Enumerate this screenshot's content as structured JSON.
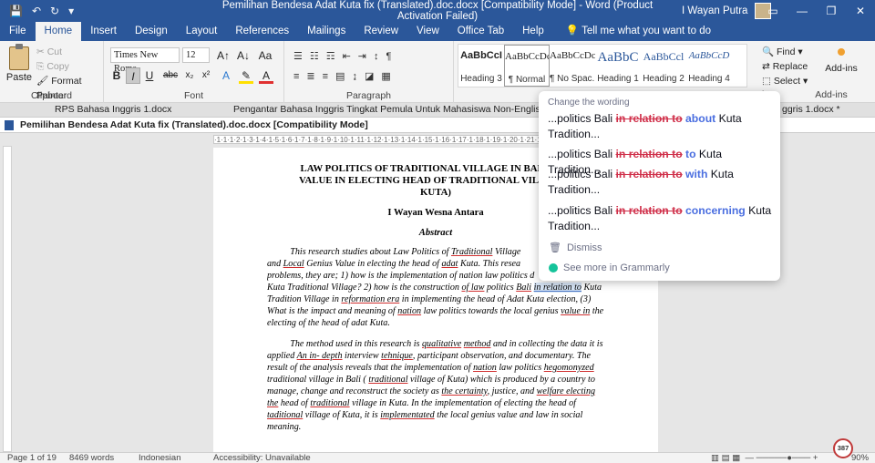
{
  "titlebar": {
    "title": "Pemilihan Bendesa Adat Kuta fix (Translated).doc.docx [Compatibility Mode] - Word (Product Activation Failed)",
    "user": "I Wayan Putra"
  },
  "tabs": [
    "File",
    "Home",
    "Insert",
    "Design",
    "Layout",
    "References",
    "Mailings",
    "Review",
    "View",
    "Office Tab",
    "Help"
  ],
  "tell_me": "Tell me what you want to do",
  "ribbon": {
    "clipboard": {
      "paste": "Paste",
      "cut": "Cut",
      "copy": "Copy",
      "format_painter": "Format Painter",
      "label": "Clipboard"
    },
    "font": {
      "name": "Times New Roma",
      "size": "12",
      "label": "Font"
    },
    "paragraph": {
      "label": "Paragraph"
    },
    "styles": [
      {
        "sample": "AaBbCcI",
        "name": "Heading 3"
      },
      {
        "sample": "AaBbCcDc",
        "name": "¶ Normal"
      },
      {
        "sample": "AaBbCcDc",
        "name": "¶ No Spac..."
      },
      {
        "sample": "AaBbC",
        "name": "Heading 1"
      },
      {
        "sample": "AaBbCcl",
        "name": "Heading 2"
      },
      {
        "sample": "AaBbCcD",
        "name": "Heading 4"
      }
    ],
    "editing": {
      "find": "Find",
      "replace": "Replace",
      "select": "Select"
    },
    "addins": {
      "label": "Add-ins",
      "group": "Add-ins"
    },
    "editing_group": "ing"
  },
  "doc_tabs": {
    "tab1": "RPS Bahasa Inggris 1.docx",
    "tab2": "Pengantar Bahasa Inggris Tingkat Pemula Untuk Mahasiswa Non-English Department.",
    "tab3": "ggris 1.docx *",
    "active": "Pemilihan Bendesa Adat Kuta fix (Translated).doc.docx [Compatibility Mode]"
  },
  "document": {
    "title_l1": "LAW  POLITICS OF TRADITIONAL VILLAGE  IN BALI AND",
    "title_l2": "VALUE  IN ELECTING HEAD OF TRADITIONAL VILLAGE  (",
    "title_l3": "KUTA)",
    "author": "I Wayan Wesna Antara",
    "abstract": "Abstract",
    "p1": {
      "l1": "This research studies about Law Politics of ",
      "l1_ul": "Traditional",
      "l1b": " Village",
      "l2a": "and ",
      "l2_ul1": "Local",
      "l2b": " Genius Value in electing the head of ",
      "l2_ul2": "adat",
      "l2c": " Kuta. This resea",
      "l3": "problems, they are; 1) how is the implementation of nation law politics d",
      "l4": "Kuta Traditional Village? 2) how is the construction ",
      "l4_ul1": "of  law",
      "l4b": " politics ",
      "l4_ul2": "Bali",
      "l4c": "  ",
      "l4_hl": "in relation to",
      "l4d": " Kuta",
      "l5a": "Tradition Village in ",
      "l5_ul": "reformation  era",
      "l5b": " in implementing the head of Adat Kuta election, (3)",
      "l6a": "What is the impact and meaning of ",
      "l6_ul1": "nation",
      "l6b": " law politics towards the local genius ",
      "l6_ul2": "value  in",
      "l6c": " the",
      "l7": "electing of the head of adat Kuta."
    },
    "p2": {
      "l1a": "The method used in this research is ",
      "l1_ul1": "qualitative",
      "l1b": " ",
      "l1_ul2": "method",
      "l1c": " and in collecting the data it is",
      "l2a": "applied ",
      "l2_ul1": "An  in-  depth",
      "l2b": " interview ",
      "l2_ul2": "tehnique",
      "l2c": ",  participant  observation,  and  documentary.  The",
      "l3a": "result  of  the  analysis  reveals  that  the  implementation  of  ",
      "l3_ul1": "nation",
      "l3b": "  law  politics  ",
      "l3_ul2": "hegomonyzed",
      "l4a": "traditional  village  in  Bali  ( ",
      "l4_ul": "traditional",
      "l4b": "  village of Kuta)  which  is produced  by  a  country  to",
      "l5a": "manage,   change and reconstruct the society as ",
      "l5_ul1": "the  certainty",
      "l5b": ",  justice,  and  ",
      "l5_ul2": "welfare electing",
      "l6_ul1": "the",
      "l6a": "  head  of  ",
      "l6_ul2": "traditional",
      "l6b": "  village  in  Kuta.  In  the  implementation  of  electing  the  head  of",
      "l7_ul1": "taditional",
      "l7a": " village of Kuta,  it  is  ",
      "l7_ul2": "implementated",
      "l7b": "  the  local  genius  value  and  law  in  social",
      "l8": "meaning."
    }
  },
  "grammarly": {
    "header": "Change the wording",
    "suggestions": [
      {
        "prefix": "...politics Bali ",
        "del": "in relation to",
        "ins": "about",
        "suffix": " Kuta Tradition..."
      },
      {
        "prefix": "...politics Bali ",
        "del": "in relation to",
        "ins": "to",
        "suffix": " Kuta Tradition..."
      },
      {
        "prefix": "...politics Bali ",
        "del": "in relation to",
        "ins": "with",
        "suffix": " Kuta Tradition..."
      },
      {
        "prefix": "...politics Bali ",
        "del": "in relation to",
        "ins": "concerning",
        "suffix": " Kuta Tradition..."
      }
    ],
    "dismiss": "Dismiss",
    "see_more": "See more in Grammarly",
    "badge": "387"
  },
  "status": {
    "page": "Page 1 of 19",
    "words": "8469 words",
    "lang": "Indonesian",
    "accessibility": "Accessibility: Unavailable",
    "zoom": "90%"
  },
  "colors": {
    "word_blue": "#2b579a",
    "grammarly_green": "#15c39a",
    "delete_red": "#d0304a",
    "insert_blue": "#4a6ee0"
  }
}
